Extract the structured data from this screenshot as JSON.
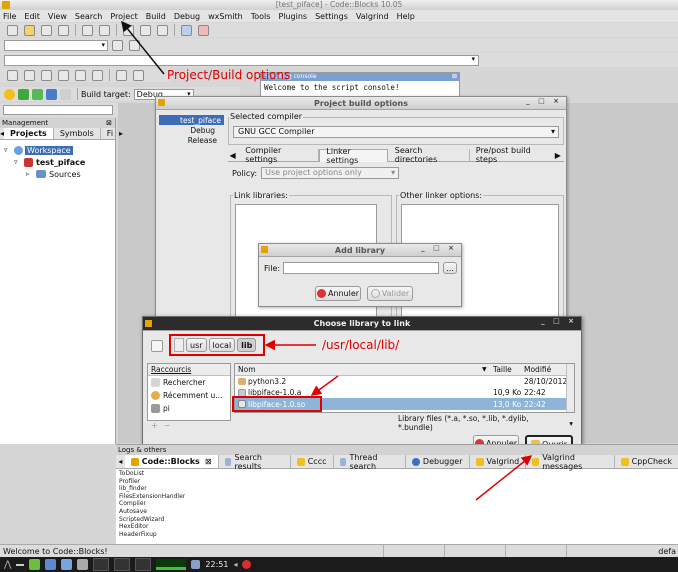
{
  "app": {
    "title": "[test_piface] - Code::Blocks 10.05"
  },
  "menu": [
    "File",
    "Edit",
    "View",
    "Search",
    "Project",
    "Build",
    "Debug",
    "wxSmith",
    "Tools",
    "Plugins",
    "Settings",
    "Valgrind",
    "Help"
  ],
  "toolbar": {
    "build_target_label": "Build target:",
    "build_target_value": "Debug"
  },
  "annotations": {
    "project_build": "Project/Build options",
    "path": "/usr/local/lib/"
  },
  "script_console": {
    "title": "Scripting console",
    "text": "Welcome to the script console!"
  },
  "management": {
    "title": "Management",
    "tabs": [
      "Projects",
      "Symbols",
      "Fi"
    ],
    "tree": {
      "workspace": "Workspace",
      "project": "test_piface",
      "folder": "Sources"
    }
  },
  "build_options": {
    "title": "Project build options",
    "targets": [
      "test_piface",
      "Debug",
      "Release"
    ],
    "compiler_label": "Selected compiler",
    "compiler_value": "GNU GCC Compiler",
    "tabs": [
      "Compiler settings",
      "Linker settings",
      "Search directories",
      "Pre/post build steps"
    ],
    "policy_label": "Policy:",
    "policy_value": "Use project options only",
    "link_libraries_label": "Link libraries:",
    "other_linker_label": "Other linker options:"
  },
  "add_library": {
    "title": "Add library",
    "file_label": "File:",
    "browse": "...",
    "cancel": "Annuler",
    "ok": "Valider"
  },
  "choose_lib": {
    "title": "Choose library to link",
    "path_segments": [
      "usr",
      "local",
      "lib"
    ],
    "shortcuts_header": "Raccourcis",
    "shortcuts": [
      "Rechercher",
      "Récemment u...",
      "pi"
    ],
    "columns": {
      "name": "Nom",
      "size": "Taille",
      "modified": "Modifié"
    },
    "files": [
      {
        "name": "python3.2",
        "size": "",
        "modified": "28/10/2012"
      },
      {
        "name": "libpiface-1.0.a",
        "size": "10,9 Ko",
        "modified": "22:42"
      },
      {
        "name": "libpiface-1.0.so",
        "size": "13,0 Ko",
        "modified": "22:42"
      }
    ],
    "filter": "Library files (*.a, *.so, *.lib, *.dylib, *.bundle)",
    "cancel": "Annuler",
    "open": "Ouvrir"
  },
  "logs": {
    "header": "Logs & others",
    "tabs": [
      "Code::Blocks",
      "Search results",
      "Cccc",
      "Thread search",
      "Debugger",
      "Valgrind",
      "Valgrind messages",
      "CppCheck"
    ],
    "lines": [
      "ToDoList",
      "Profiler",
      "lib_finder",
      "FilesExtensionHandler",
      "Compiler",
      "Autosave",
      "ScriptedWizard",
      "HexEditor",
      "HeaderFixup"
    ]
  },
  "status": {
    "left": "Welcome to Code::Blocks!",
    "right": "defa"
  },
  "taskbar": {
    "time": "22:51"
  },
  "colors": {
    "selection": "#8fb4d9",
    "annotation": "#e00000",
    "taskbar": "#1b1b1b"
  }
}
